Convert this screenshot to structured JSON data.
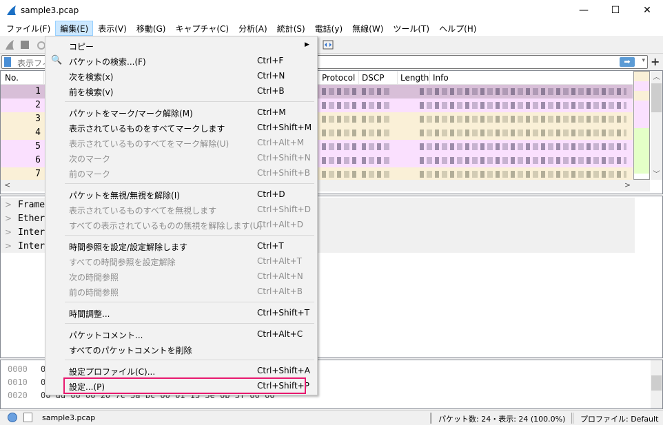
{
  "window": {
    "title": "sample3.pcap",
    "minimize": "—",
    "maximize": "☐",
    "close": "✕"
  },
  "menubar": [
    "ファイル(F)",
    "編集(E)",
    "表示(V)",
    "移動(G)",
    "キャプチャ(C)",
    "分析(A)",
    "統計(S)",
    "電話(y)",
    "無線(W)",
    "ツール(T)",
    "ヘルプ(H)"
  ],
  "active_menu": "編集(E)",
  "filter": {
    "placeholder": "表示フィ",
    "apply_icon": "➡",
    "dropdown_icon": "▾",
    "add_icon": "+"
  },
  "packet_list": {
    "columns": [
      "No.",
      "Protocol",
      "DSCP",
      "Length",
      "Info"
    ],
    "rows": [
      {
        "no": "1",
        "color": "purple-selected"
      },
      {
        "no": "2",
        "color": "purple"
      },
      {
        "no": "3",
        "color": "tan"
      },
      {
        "no": "4",
        "color": "tan"
      },
      {
        "no": "5",
        "color": "purple"
      },
      {
        "no": "6",
        "color": "purple"
      },
      {
        "no": "7",
        "color": "tan"
      }
    ]
  },
  "details": [
    "Frame",
    "Ether",
    "Inter",
    "Inter"
  ],
  "bytes": {
    "offsets": [
      "0000",
      "0010",
      "0020"
    ],
    "hex": [
      "0",
      "0",
      "00 dd 00 00 20 7c 5a bc  00 01 15 5e 0b 5f 00 00"
    ]
  },
  "edit_menu": [
    {
      "label": "コピー",
      "shortcut": "",
      "submenu": true,
      "enabled": true
    },
    {
      "label": "パケットの検索...(F)",
      "shortcut": "Ctrl+F",
      "enabled": true,
      "icon": "search-icon"
    },
    {
      "label": "次を検索(x)",
      "shortcut": "Ctrl+N",
      "enabled": true
    },
    {
      "label": "前を検索(v)",
      "shortcut": "Ctrl+B",
      "enabled": true
    },
    {
      "separator": true
    },
    {
      "label": "パケットをマーク/マーク解除(M)",
      "shortcut": "Ctrl+M",
      "enabled": true
    },
    {
      "label": "表示されているものをすべてマークします",
      "shortcut": "Ctrl+Shift+M",
      "enabled": true
    },
    {
      "label": "表示されているものすべてをマーク解除(U)",
      "shortcut": "Ctrl+Alt+M",
      "enabled": false
    },
    {
      "label": "次のマーク",
      "shortcut": "Ctrl+Shift+N",
      "enabled": false
    },
    {
      "label": "前のマーク",
      "shortcut": "Ctrl+Shift+B",
      "enabled": false
    },
    {
      "separator": true
    },
    {
      "label": "パケットを無視/無視を解除(I)",
      "shortcut": "Ctrl+D",
      "enabled": true
    },
    {
      "label": "表示されているものすべてを無視します",
      "shortcut": "Ctrl+Shift+D",
      "enabled": false
    },
    {
      "label": "すべての表示されているものの無視を解除します(U)",
      "shortcut": "Ctrl+Alt+D",
      "enabled": false
    },
    {
      "separator": true
    },
    {
      "label": "時間参照を設定/設定解除します",
      "shortcut": "Ctrl+T",
      "enabled": true
    },
    {
      "label": "すべての時間参照を設定解除",
      "shortcut": "Ctrl+Alt+T",
      "enabled": false
    },
    {
      "label": "次の時間参照",
      "shortcut": "Ctrl+Alt+N",
      "enabled": false
    },
    {
      "label": "前の時間参照",
      "shortcut": "Ctrl+Alt+B",
      "enabled": false
    },
    {
      "separator": true
    },
    {
      "label": "時間調整...",
      "shortcut": "Ctrl+Shift+T",
      "enabled": true
    },
    {
      "separator": true
    },
    {
      "label": "パケットコメント...",
      "shortcut": "Ctrl+Alt+C",
      "enabled": true
    },
    {
      "label": "すべてのパケットコメントを削除",
      "shortcut": "",
      "enabled": true
    },
    {
      "separator": true
    },
    {
      "label": "設定プロファイル(C)...",
      "shortcut": "Ctrl+Shift+A",
      "enabled": true
    },
    {
      "label": "設定...(P)",
      "shortcut": "Ctrl+Shift+P",
      "enabled": true,
      "highlighted": true
    }
  ],
  "status": {
    "file": "sample3.pcap",
    "packets": "パケット数: 24・表示: 24 (100.0%)",
    "profile": "プロファイル: Default"
  },
  "colors": {
    "highlight_border": "#e8186e",
    "row_purple": "#fae0fe",
    "row_purple_selected": "#d8bfd8",
    "row_tan": "#faf0d7",
    "menu_active": "#cce8ff"
  }
}
